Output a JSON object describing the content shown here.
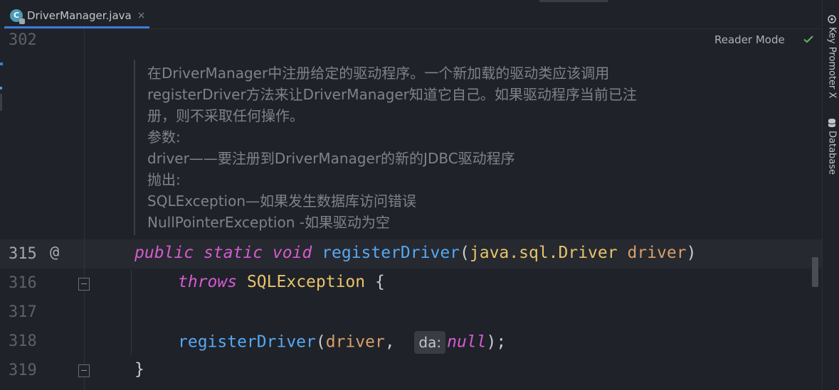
{
  "tab": {
    "icon": "java-class-icon",
    "label": "DriverManager.java",
    "close": "×"
  },
  "reader_mode": {
    "label": "Reader Mode"
  },
  "sidebar": {
    "items": [
      {
        "label": "Key Promoter X",
        "icon": "key-promoter-icon"
      },
      {
        "label": "Database",
        "icon": "database-icon"
      }
    ]
  },
  "gutter": {
    "lines": [
      "302",
      "315",
      "316",
      "317",
      "318",
      "319"
    ],
    "annotation": "@"
  },
  "doc": {
    "lines": [
      "在DriverManager中注册给定的驱动程序。一个新加载的驱动类应该调用",
      "registerDriver方法来让DriverManager知道它自己。如果驱动程序当前已注",
      "册，则不采取任何操作。",
      "参数:",
      "driver——要注册到DriverManager的新的JDBC驱动程序",
      "抛出:",
      "SQLException—如果发生数据库访问错误",
      "NullPointerException -如果驱动为空"
    ]
  },
  "code": {
    "l315": {
      "kw1": "public",
      "kw2": "static",
      "kw3": "void",
      "fn": "registerDriver",
      "open": "(",
      "type": "java.sql.Driver",
      "param": "driver",
      "close": ")"
    },
    "l316": {
      "kw": "throws",
      "type": "SQLException",
      "brace": "{"
    },
    "l318": {
      "fn": "registerDriver",
      "open": "(",
      "param": "driver",
      "comma": ",",
      "hint": "da:",
      "kw": "null",
      "end": ");"
    },
    "l319": {
      "brace": "}"
    }
  }
}
